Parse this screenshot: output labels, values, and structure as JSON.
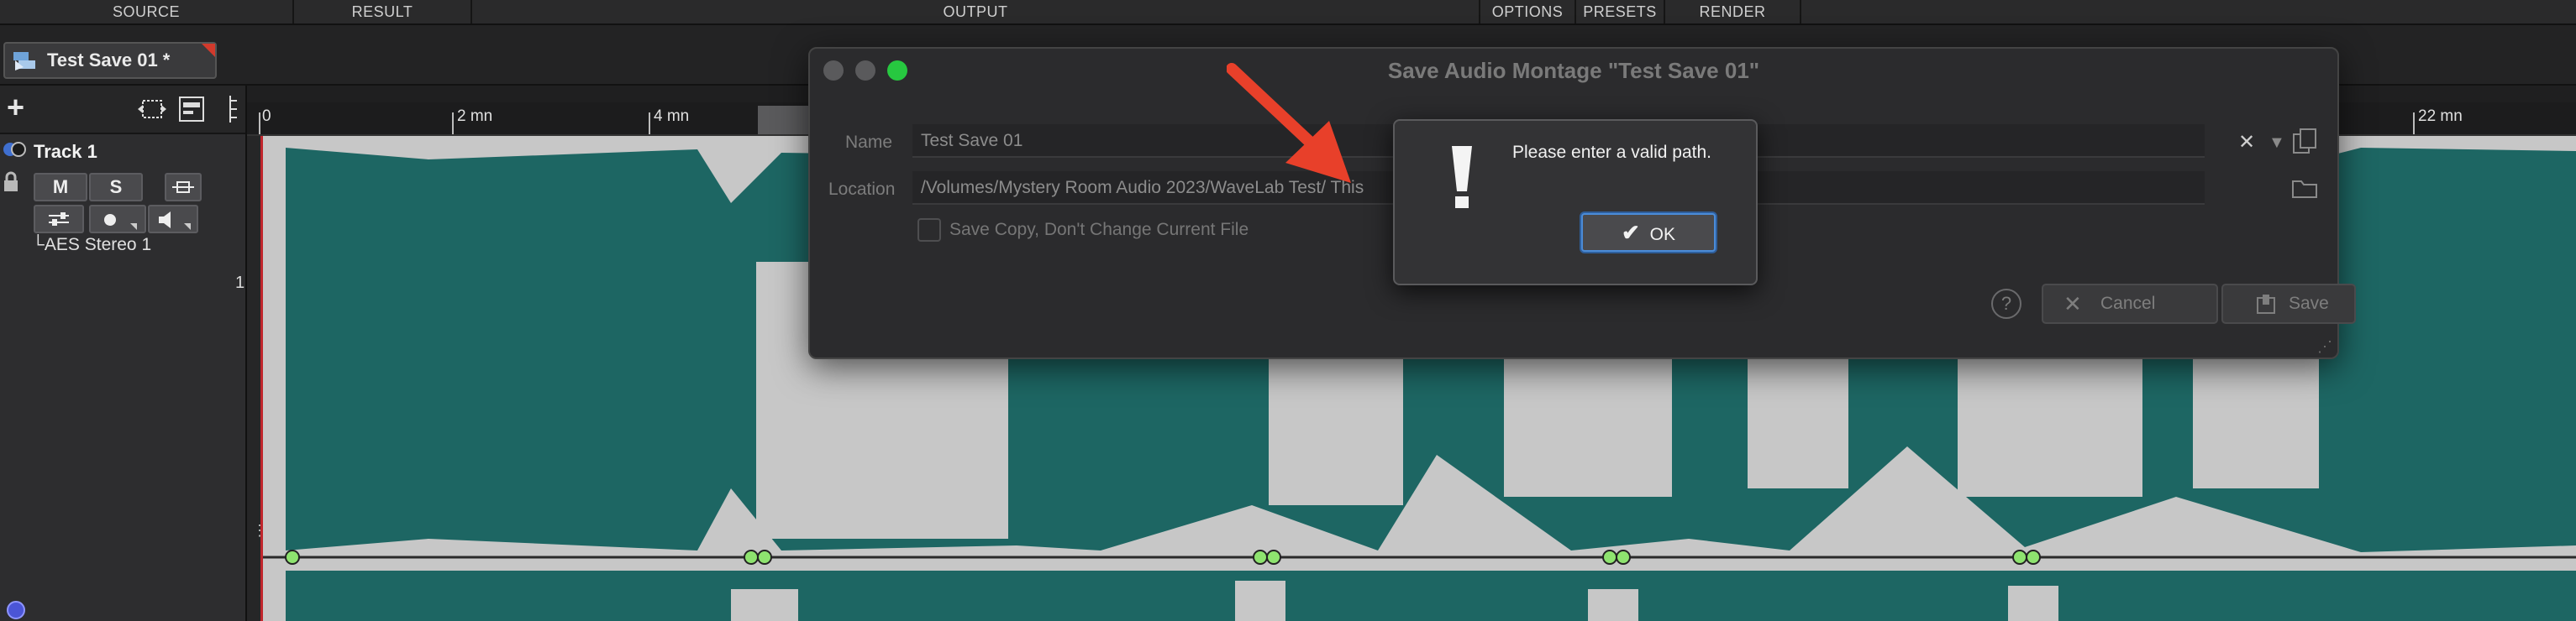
{
  "top_tabs": [
    "SOURCE",
    "RESULT",
    "OUTPUT",
    "OPTIONS",
    "PRESETS",
    "RENDER"
  ],
  "document_tab": {
    "label": "Test Save 01 *"
  },
  "track": {
    "name": "Track 1",
    "mute_label": "M",
    "solo_label": "S",
    "output": "└AES Stereo 1",
    "number": "1"
  },
  "ruler": {
    "marks": [
      "0",
      "2 mn",
      "4 mn",
      "22 mn"
    ]
  },
  "dialog": {
    "title": "Save Audio Montage \"Test Save 01\"",
    "name_label": "Name",
    "name_value": "Test Save 01",
    "location_label": "Location",
    "location_value": "/Volumes/Mystery Room Audio 2023/WaveLab Test/ This",
    "save_copy_label": "Save Copy, Don't Change Current File",
    "help_label": "?",
    "cancel_label": "Cancel",
    "save_label": "Save"
  },
  "alert": {
    "message": "Please enter a valid path.",
    "ok_label": "OK"
  },
  "colors": {
    "waveform": "#1d6663",
    "waveform_bg": "#c7c7c7",
    "arrow": "#e8402a",
    "focus_ring": "#4b8cd8"
  }
}
